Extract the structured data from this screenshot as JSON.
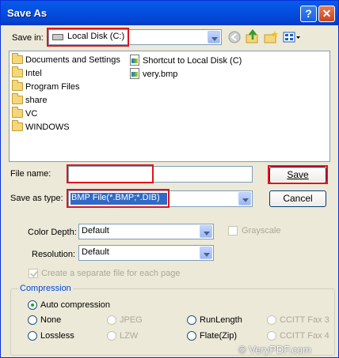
{
  "window": {
    "title": "Save As",
    "help_label": "?",
    "close_label": "✕"
  },
  "save_in": {
    "label": "Save in:",
    "underline_char": "i",
    "value": "Local Disk (C:)"
  },
  "toolbar": {
    "icons": [
      "back-icon",
      "up-folder-icon",
      "new-folder-icon",
      "view-menu-icon"
    ]
  },
  "files": {
    "col1": [
      "Documents and Settings",
      "Intel",
      "Program Files",
      "share",
      "VC",
      "WINDOWS"
    ],
    "col2": [
      "Shortcut to Local Disk (C)",
      "very.bmp"
    ]
  },
  "file_name": {
    "label": "File name:",
    "value": ""
  },
  "save_as_type": {
    "label": "Save as type:",
    "value": "BMP File(*.BMP;*.DIB)"
  },
  "buttons": {
    "save": "Save",
    "cancel": "Cancel"
  },
  "options": {
    "color_depth": {
      "label": "Color Depth:",
      "value": "Default"
    },
    "grayscale": {
      "label": "Grayscale",
      "checked": false,
      "enabled": false
    },
    "resolution": {
      "label": "Resolution:",
      "value": "Default"
    },
    "separate_file": {
      "label": "Create a separate file for each page",
      "checked": true,
      "enabled": false
    }
  },
  "compression": {
    "label": "Compression",
    "auto": "Auto compression",
    "options": [
      {
        "label": "None",
        "enabled": true
      },
      {
        "label": "JPEG",
        "enabled": false
      },
      {
        "label": "RunLength",
        "enabled": true
      },
      {
        "label": "CCITT Fax 3",
        "enabled": false
      },
      {
        "label": "Lossless",
        "enabled": true
      },
      {
        "label": "LZW",
        "enabled": false
      },
      {
        "label": "Flate(Zip)",
        "enabled": true
      },
      {
        "label": "CCITT Fax 4",
        "enabled": false
      }
    ]
  },
  "watermark": "© VeryPDF.com",
  "colors": {
    "title_bar": "#0450e2",
    "dialog_bg": "#ece9d8",
    "highlight": "#316ac5",
    "annotation_red": "#e0141a"
  }
}
